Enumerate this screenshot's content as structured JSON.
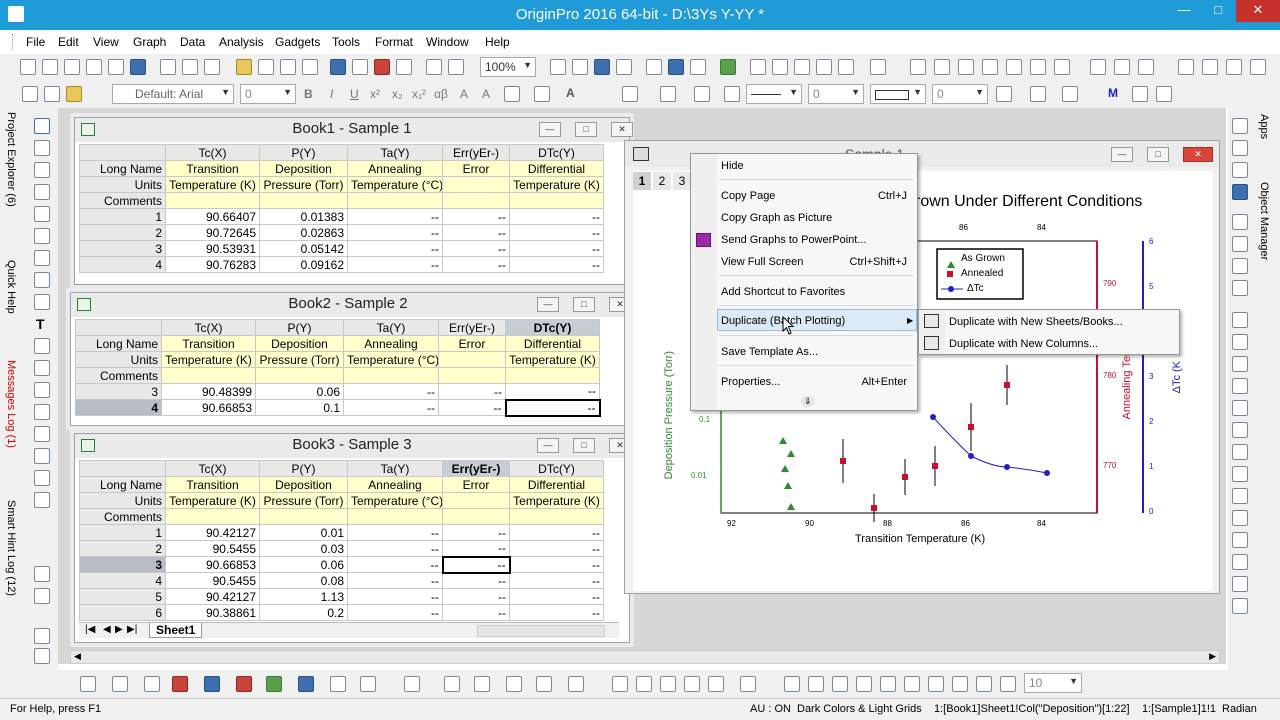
{
  "app": {
    "title": "OriginPro 2016 64-bit - D:\\3Ys Y-YY *"
  },
  "menu": [
    "File",
    "Edit",
    "View",
    "Graph",
    "Data",
    "Analysis",
    "Gadgets",
    "Tools",
    "Format",
    "Window",
    "Help"
  ],
  "toolbar": {
    "zoom": "100%",
    "font": "Default: Arial",
    "font_size": "0",
    "line_width": "0",
    "pattern_width": "0",
    "bottom_size": "10"
  },
  "left_panels": [
    "Project Explorer (6)",
    "Quick Help",
    "Messages Log (1)",
    "Smart Hint Log (12)"
  ],
  "right_panels": [
    "Apps",
    "Object Manager"
  ],
  "book1": {
    "title": "Book1 - Sample 1",
    "columns": [
      "Tc(X)",
      "P(Y)",
      "Ta(Y)",
      "Err(yEr-)",
      "DTc(Y)"
    ],
    "long_name": [
      "Transition",
      "Deposition",
      "Annealing",
      "Error",
      "Differential"
    ],
    "units": [
      "Temperature (K)",
      "Pressure (Torr)",
      "Temperature (°C)",
      "",
      "Temperature (K)"
    ],
    "row_labels": [
      "Long Name",
      "Units",
      "Comments"
    ],
    "rows": [
      [
        "1",
        "90.66407",
        "0.01383",
        "--",
        "--",
        "--"
      ],
      [
        "2",
        "90.72645",
        "0.02863",
        "--",
        "--",
        "--"
      ],
      [
        "3",
        "90.53931",
        "0.05142",
        "--",
        "--",
        "--"
      ],
      [
        "4",
        "90.76283",
        "0.09162",
        "--",
        "--",
        "--"
      ]
    ]
  },
  "book2": {
    "title": "Book2 - Sample 2",
    "columns": [
      "Tc(X)",
      "P(Y)",
      "Ta(Y)",
      "Err(yEr-)",
      "DTc(Y)"
    ],
    "long_name": [
      "Transition",
      "Deposition",
      "Annealing",
      "Error",
      "Differential"
    ],
    "units": [
      "Temperature (K)",
      "Pressure (Torr)",
      "Temperature (°C)",
      "",
      "Temperature (K)"
    ],
    "row_labels": [
      "Long Name",
      "Units",
      "Comments"
    ],
    "rows": [
      [
        "3",
        "90.48399",
        "0.06",
        "--",
        "--",
        "--"
      ],
      [
        "4",
        "90.66853",
        "0.1",
        "--",
        "--",
        "--"
      ]
    ]
  },
  "book3": {
    "title": "Book3 - Sample 3",
    "columns": [
      "Tc(X)",
      "P(Y)",
      "Ta(Y)",
      "Err(yEr-)",
      "DTc(Y)"
    ],
    "long_name": [
      "Transition",
      "Deposition",
      "Annealing",
      "Error",
      "Differential"
    ],
    "units": [
      "Temperature (K)",
      "Pressure (Torr)",
      "Temperature (°C)",
      "",
      "Temperature (K)"
    ],
    "row_labels": [
      "Long Name",
      "Units",
      "Comments"
    ],
    "rows": [
      [
        "1",
        "90.42127",
        "0.01",
        "--",
        "--",
        "--"
      ],
      [
        "2",
        "90.5455",
        "0.03",
        "--",
        "--",
        "--"
      ],
      [
        "3",
        "90.66853",
        "0.06",
        "--",
        "--",
        "--"
      ],
      [
        "4",
        "90.5455",
        "0.08",
        "--",
        "--",
        "--"
      ],
      [
        "5",
        "90.42127",
        "1.13",
        "--",
        "--",
        "--"
      ],
      [
        "6",
        "90.38861",
        "0.2",
        "--",
        "--",
        "--"
      ]
    ],
    "sheet_tab": "Sheet1"
  },
  "graph": {
    "title_partial": "Sample 1 - ",
    "layer_tabs": [
      "1",
      "2",
      "3"
    ],
    "heading": "rown Under Different Conditions",
    "xlabel": "Transition Temperature (K)",
    "ylabel_left": "Deposition Pressure (Torr)",
    "ylabel_right1": "Annealing Temper",
    "ylabel_right2": "ΔTc (K",
    "x_ticks": [
      "92",
      "90",
      "88",
      "86",
      "84"
    ],
    "top_ticks": [
      "86",
      "84"
    ],
    "left_ticks": [
      "0.1",
      "0.01"
    ],
    "right1_ticks": [
      "790",
      "780",
      "770"
    ],
    "right2_ticks": [
      "6",
      "5",
      "4",
      "3",
      "2",
      "1",
      "0"
    ],
    "legend": [
      "As Grown",
      "Annealed",
      "ΔTc"
    ]
  },
  "context_menu": [
    {
      "label": "Hide",
      "shortcut": ""
    },
    {
      "label": "Copy Page",
      "shortcut": "Ctrl+J"
    },
    {
      "label": "Copy Graph as Picture",
      "shortcut": ""
    },
    {
      "label": "Send Graphs to PowerPoint...",
      "shortcut": ""
    },
    {
      "label": "View Full Screen",
      "shortcut": "Ctrl+Shift+J"
    },
    {
      "label": "Add Shortcut to Favorites",
      "shortcut": ""
    },
    {
      "label": "Duplicate (Batch Plotting)",
      "shortcut": ""
    },
    {
      "label": "Save Template As...",
      "shortcut": ""
    },
    {
      "label": "Properties...",
      "shortcut": "Alt+Enter"
    }
  ],
  "submenu": [
    "Duplicate with New Sheets/Books...",
    "Duplicate with New Columns..."
  ],
  "status": {
    "help": "For Help, press F1",
    "au": "AU : ON",
    "theme": "Dark Colors & Light Grids",
    "col": "1:[Book1]Sheet1!Col(\"Deposition\")[1:22]",
    "sample": "1:[Sample1]1!1",
    "unit": "Radian"
  },
  "colors": {
    "titlebar": "#1f9cd7",
    "meta_bg": "#ffffcc",
    "green": "#2e8b2e",
    "red": "#c8102e",
    "blue": "#2020c0"
  }
}
